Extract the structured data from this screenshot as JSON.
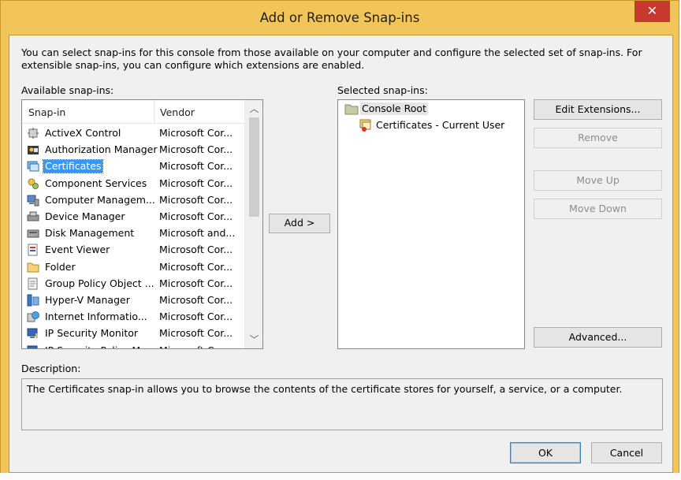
{
  "window": {
    "title": "Add or Remove Snap-ins",
    "close_glyph": "✕",
    "intro_text": "You can select snap-ins for this console from those available on your computer and configure the selected set of snap-ins. For extensible snap-ins, you can configure which extensions are enabled."
  },
  "available": {
    "label": "Available snap-ins:",
    "columns": {
      "name": "Snap-in",
      "vendor": "Vendor"
    },
    "rows": [
      {
        "name": "ActiveX Control",
        "vendor": "Microsoft Cor...",
        "icon": "activex-icon"
      },
      {
        "name": "Authorization Manager",
        "vendor": "Microsoft Cor...",
        "icon": "authorization-icon"
      },
      {
        "name": "Certificates",
        "vendor": "Microsoft Cor...",
        "icon": "certificates-icon",
        "selected": true
      },
      {
        "name": "Component Services",
        "vendor": "Microsoft Cor...",
        "icon": "component-services-icon"
      },
      {
        "name": "Computer Managem...",
        "vendor": "Microsoft Cor...",
        "icon": "computer-management-icon"
      },
      {
        "name": "Device Manager",
        "vendor": "Microsoft Cor...",
        "icon": "device-manager-icon"
      },
      {
        "name": "Disk Management",
        "vendor": "Microsoft and...",
        "icon": "disk-management-icon"
      },
      {
        "name": "Event Viewer",
        "vendor": "Microsoft Cor...",
        "icon": "event-viewer-icon"
      },
      {
        "name": "Folder",
        "vendor": "Microsoft Cor...",
        "icon": "folder-icon"
      },
      {
        "name": "Group Policy Object ...",
        "vendor": "Microsoft Cor...",
        "icon": "group-policy-icon"
      },
      {
        "name": "Hyper-V Manager",
        "vendor": "Microsoft Cor...",
        "icon": "hyper-v-icon"
      },
      {
        "name": "Internet Informatio...",
        "vendor": "Microsoft Cor...",
        "icon": "iis-icon"
      },
      {
        "name": "IP Security Monitor",
        "vendor": "Microsoft Cor...",
        "icon": "ip-security-icon"
      },
      {
        "name": "IP Security Policy M...",
        "vendor": "Microsoft Cor...",
        "icon": "ip-security-policy-icon"
      }
    ]
  },
  "add_button": "Add >",
  "selected": {
    "label": "Selected snap-ins:",
    "root": "Console Root",
    "children": [
      "Certificates - Current User"
    ]
  },
  "side_buttons": {
    "edit_extensions": "Edit Extensions...",
    "remove": "Remove",
    "move_up": "Move Up",
    "move_down": "Move Down",
    "advanced": "Advanced..."
  },
  "description": {
    "label": "Description:",
    "text": "The Certificates snap-in allows you to browse the contents of the certificate stores for yourself, a service, or a computer."
  },
  "footer": {
    "ok": "OK",
    "cancel": "Cancel"
  },
  "colors": {
    "frame": "#f2c55a",
    "close": "#c7382f",
    "selection": "#3399ff"
  }
}
